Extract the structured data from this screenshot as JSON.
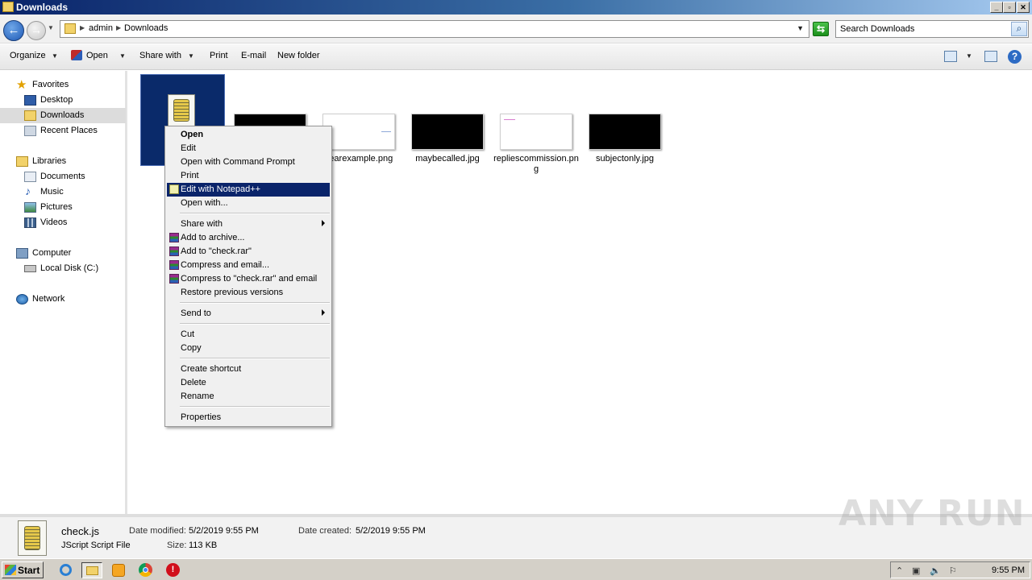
{
  "window": {
    "title": "Downloads"
  },
  "address": {
    "crumbs": [
      "admin",
      "Downloads"
    ],
    "search_placeholder": "Search Downloads"
  },
  "toolbar": {
    "organize": "Organize",
    "open": "Open",
    "share_with": "Share with",
    "print": "Print",
    "email": "E-mail",
    "new_folder": "New folder"
  },
  "nav": {
    "favorites": "Favorites",
    "desktop": "Desktop",
    "downloads": "Downloads",
    "recent_places": "Recent Places",
    "libraries": "Libraries",
    "documents": "Documents",
    "music": "Music",
    "pictures": "Pictures",
    "videos": "Videos",
    "computer": "Computer",
    "local_disk": "Local Disk (C:)",
    "network": "Network"
  },
  "files": [
    {
      "name": "check.js"
    },
    {
      "name": ""
    },
    {
      "name": "yearexample.png"
    },
    {
      "name": "maybecalled.jpg"
    },
    {
      "name": "repliescommission.png"
    },
    {
      "name": "subjectonly.jpg"
    }
  ],
  "context_menu": {
    "open": "Open",
    "edit": "Edit",
    "open_cmd": "Open with Command Prompt",
    "print": "Print",
    "edit_npp": "Edit with Notepad++",
    "open_with": "Open with...",
    "share_with": "Share with",
    "add_archive": "Add to archive...",
    "add_rar": "Add to \"check.rar\"",
    "compress_email": "Compress and email...",
    "compress_rar_email": "Compress to \"check.rar\" and email",
    "restore": "Restore previous versions",
    "send_to": "Send to",
    "cut": "Cut",
    "copy": "Copy",
    "create_shortcut": "Create shortcut",
    "delete": "Delete",
    "rename": "Rename",
    "properties": "Properties"
  },
  "details": {
    "name": "check.js",
    "type": "JScript Script File",
    "modified_label": "Date modified:",
    "modified": "5/2/2019 9:55 PM",
    "size_label": "Size:",
    "size": "113 KB",
    "created_label": "Date created:",
    "created": "5/2/2019 9:55 PM"
  },
  "taskbar": {
    "start": "Start",
    "clock": "9:55 PM"
  },
  "watermark": "ANY RUN"
}
